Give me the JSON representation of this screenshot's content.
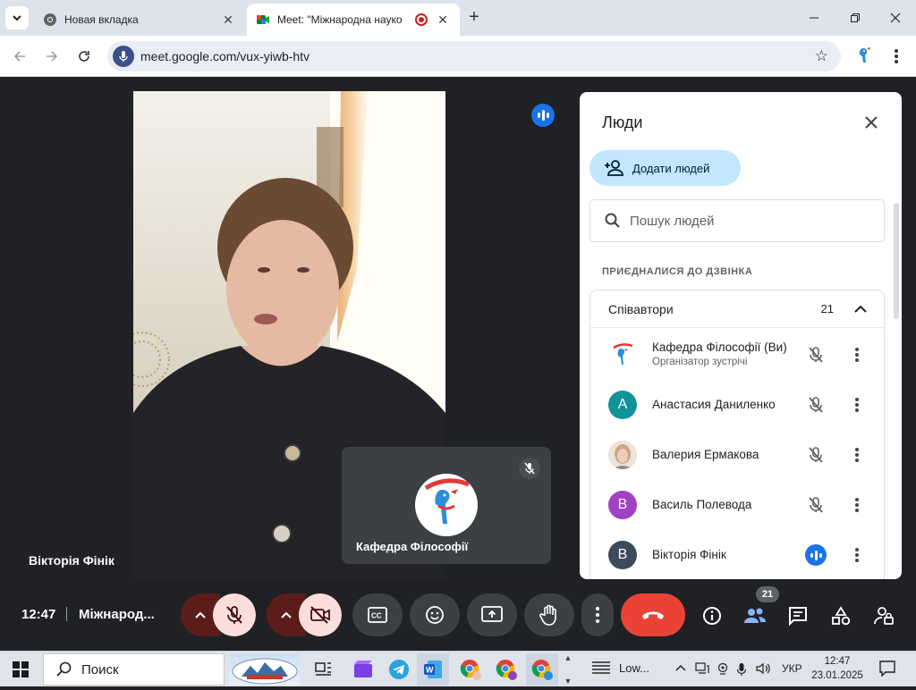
{
  "browser": {
    "tabs": [
      {
        "title": "Новая вкладка",
        "active": false
      },
      {
        "title": "Meet: \"Міжнародна науко",
        "active": true
      }
    ],
    "url": "meet.google.com/vux-yiwb-htv"
  },
  "stage": {
    "main_participant_name": "Вікторія Фінік",
    "self_tile_name": "Кафедра Філософії"
  },
  "people_panel": {
    "title": "Люди",
    "add_people_label": "Додати людей",
    "search_placeholder": "Пошук людей",
    "section_label": "ПРИЄДНАЛИСЯ ДО ДЗВІНКА",
    "group_name": "Співавтори",
    "group_count": "21",
    "participants": [
      {
        "name": "Кафедра Філософії (Ви)",
        "role": "Організатор зустрічі",
        "avatar": "logo",
        "status": "muted"
      },
      {
        "name": "Анастасия Даниленко",
        "avatar_letter": "А",
        "avatar_color": "#12939a",
        "status": "muted"
      },
      {
        "name": "Валерия Ермакова",
        "avatar": "photo",
        "status": "muted"
      },
      {
        "name": "Василь Полевода",
        "avatar_letter": "В",
        "avatar_color": "#a142c4",
        "status": "muted"
      },
      {
        "name": "Вікторія Фінік",
        "avatar_letter": "В",
        "avatar_color": "#3c4a5a",
        "status": "speaking"
      }
    ]
  },
  "controls": {
    "time": "12:47",
    "meeting_title": "Міжнарод...",
    "people_count": "21",
    "hangup_color": "#ea4335",
    "muted_color": "#f9dedc"
  },
  "taskbar": {
    "search_label": "Поиск",
    "weather_label": "Low...",
    "language": "УКР",
    "time": "12:47",
    "date": "23.01.2025"
  }
}
